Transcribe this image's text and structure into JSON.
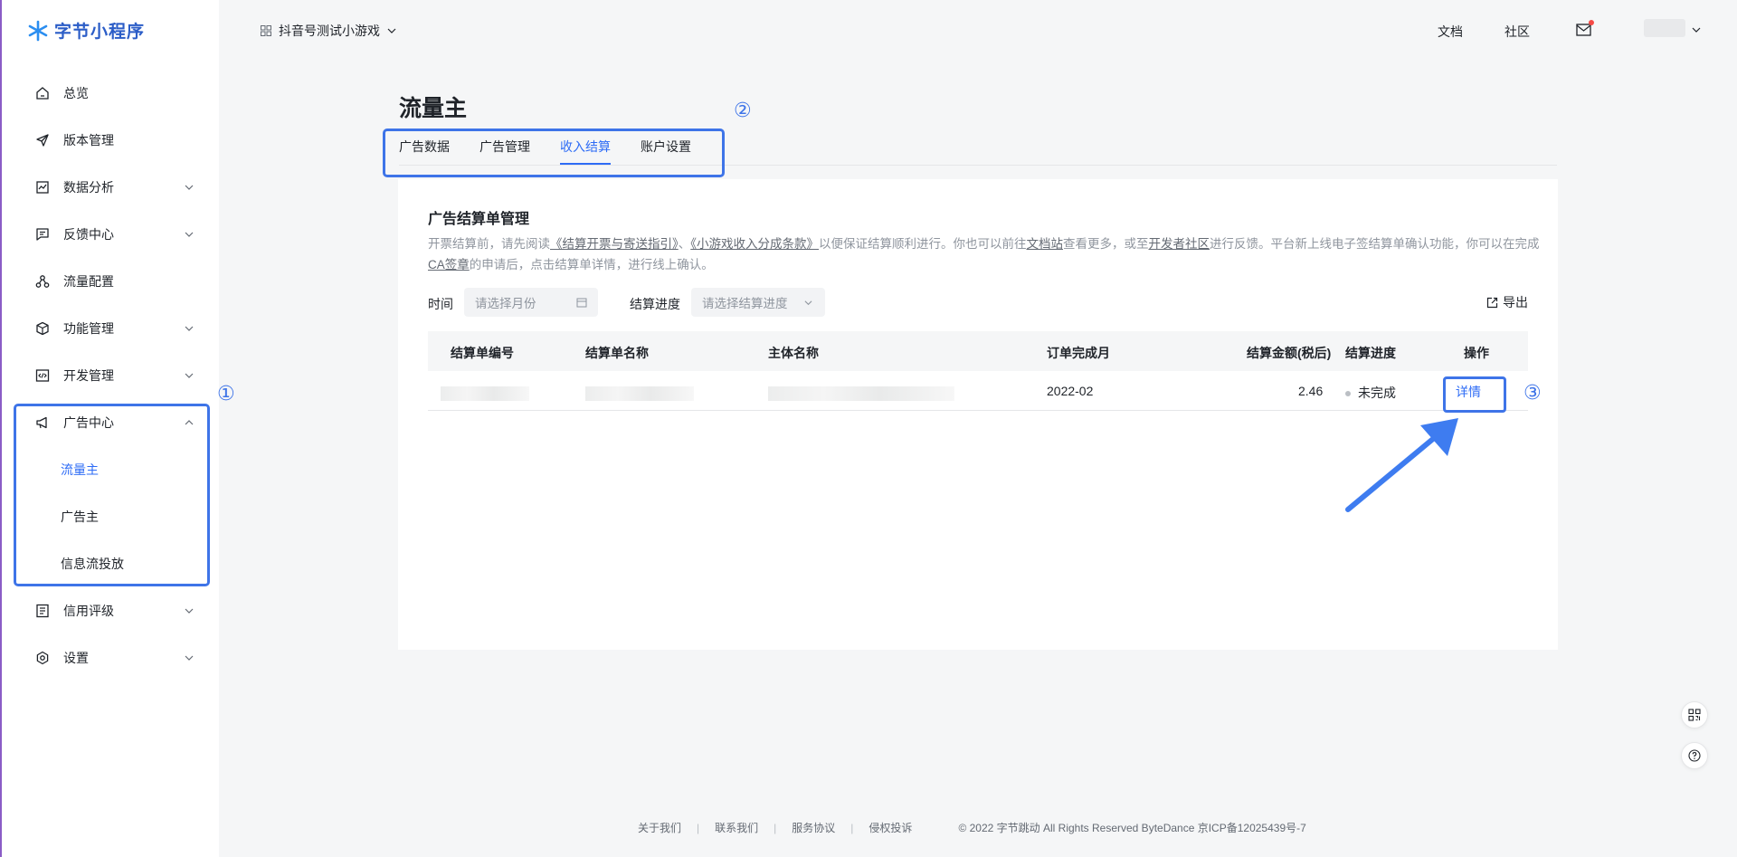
{
  "brand": {
    "name": "字节小程序"
  },
  "header": {
    "app_name": "抖音号测试小游戏",
    "links": [
      "文档",
      "社区"
    ]
  },
  "sidebar": {
    "items": [
      {
        "label": "总览",
        "icon": "home-icon"
      },
      {
        "label": "版本管理",
        "icon": "send-icon"
      },
      {
        "label": "数据分析",
        "icon": "chart-icon"
      },
      {
        "label": "反馈中心",
        "icon": "feedback-icon"
      },
      {
        "label": "流量配置",
        "icon": "share-icon"
      },
      {
        "label": "功能管理",
        "icon": "box-icon"
      },
      {
        "label": "开发管理",
        "icon": "code-icon"
      },
      {
        "label": "广告中心",
        "icon": "megaphone-icon"
      },
      {
        "label": "信用评级",
        "icon": "list-icon"
      },
      {
        "label": "设置",
        "icon": "settings-icon"
      }
    ],
    "sub_items": [
      "流量主",
      "广告主",
      "信息流投放"
    ],
    "active_sub": "流量主"
  },
  "annotations": {
    "one": "①",
    "two": "②",
    "three": "③"
  },
  "main": {
    "title": "流量主",
    "tabs": [
      "广告数据",
      "广告管理",
      "收入结算",
      "账户设置"
    ],
    "active_tab": "收入结算",
    "card": {
      "title": "广告结算单管理",
      "notice": {
        "p1": "开票结算前，请先阅读",
        "l1": "《结算开票与寄送指引》",
        "p2": "、",
        "l2": "《小游戏收入分成条款》",
        "p3": "以便保证结算顺利进行。你也可以前往",
        "l3": "文档站",
        "p4": "查看更多，或至",
        "l4": "开发者社区",
        "p5": "进行反馈。平台新上线电子签结算单确认功能，你可以在完成",
        "l5": "CA签章",
        "p6": "的申请后，点击结算单详情，进行线上确认。"
      },
      "filters": {
        "time_label": "时间",
        "time_placeholder": "请选择月份",
        "progress_label": "结算进度",
        "progress_placeholder": "请选择结算进度"
      },
      "export_label": "导出",
      "table": {
        "columns": [
          "结算单编号",
          "结算单名称",
          "主体名称",
          "订单完成月",
          "结算金额(税后)",
          "结算进度",
          "操作"
        ],
        "rows": [
          {
            "month": "2022-02",
            "amount": "2.46",
            "status": "未完成",
            "action": "详情"
          }
        ]
      }
    }
  },
  "footer": {
    "links": [
      "关于我们",
      "联系我们",
      "服务协议",
      "侵权投诉"
    ],
    "copyright": "© 2022 字节跳动 All Rights Reserved ByteDance 京ICP备12025439号-7"
  }
}
